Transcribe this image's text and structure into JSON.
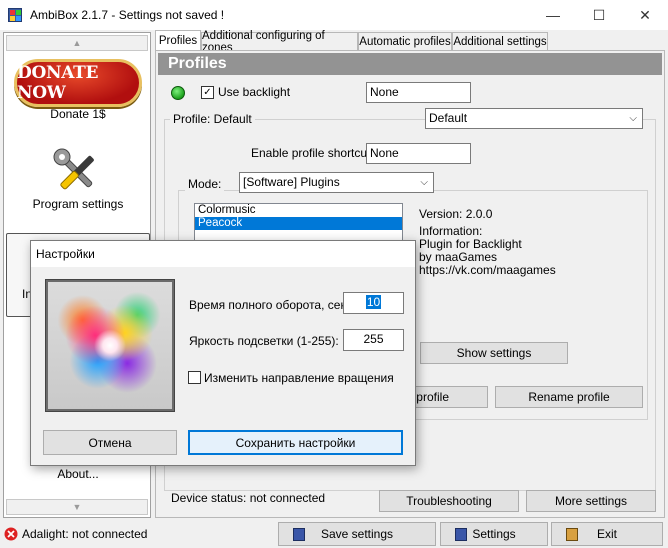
{
  "window": {
    "title": "AmbiBox 2.1.7  - Settings not saved !",
    "minimize": "—",
    "maximize": "☐",
    "close": "✕"
  },
  "sidebar": {
    "up_arrow": "▲",
    "down_arrow": "▼",
    "donate_button": "DONATE NOW",
    "donate_label": "Donate 1$",
    "program_settings_label": "Program settings",
    "partial_label": "In",
    "about_label": "About..."
  },
  "tabs": [
    "Profiles",
    "Additional configuring of zones",
    "Automatic profiles",
    "Additional settings"
  ],
  "profiles": {
    "header": "Profiles",
    "use_backlight": "Use backlight",
    "use_backlight_checked": true,
    "backlight_shortcut": "None",
    "profile_label": "Profile: Default",
    "profile_value": "Default",
    "enable_shortcut_label": "Enable profile shortcut:",
    "enable_shortcut_value": "None",
    "mode_label": "Mode:",
    "mode_value": "[Software] Plugins",
    "plugins": [
      "Colormusic",
      "Peacock"
    ],
    "selected_plugin": "Peacock",
    "version": "Version: 2.0.0",
    "information_label": "Information:",
    "info_lines": [
      "Plugin for Backlight",
      "by maaGames",
      "https://vk.com/maagames"
    ],
    "show_settings": "Show settings",
    "delete_profile_partial": "e profile",
    "rename_profile": "Rename profile",
    "device_status": "Device status: not connected",
    "troubleshooting": "Troubleshooting",
    "more_settings": "More settings"
  },
  "statusbar": {
    "adalight_status": "Adalight: not connected",
    "save_settings": "Save settings",
    "settings": "Settings",
    "exit": "Exit"
  },
  "dialog": {
    "title": "Настройки",
    "rotation_label": "Время полного оборота, сек:",
    "rotation_value": "10",
    "brightness_label": "Яркость подсветки (1-255):",
    "brightness_value": "255",
    "reverse_label": "Изменить направление вращения",
    "reverse_checked": false,
    "cancel": "Отмена",
    "save": "Сохранить настройки"
  },
  "colors": {
    "header_bg": "#939393",
    "selection": "#0078d7",
    "led_green": "#1ca01c"
  }
}
